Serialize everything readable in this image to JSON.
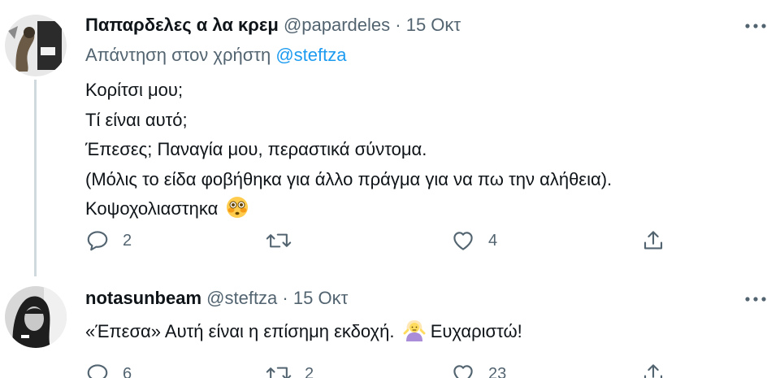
{
  "tweets": [
    {
      "display_name": "Παπαρδελες α λα κρεμ",
      "handle": "@papardeles",
      "separator": "·",
      "date": "15 Οκτ",
      "reply_prefix": "Απάντηση στον χρήστη",
      "reply_mention": "@steftza",
      "lines": [
        "Κορίτσι μου;",
        "Τί είναι αυτό;",
        "Έπεσες; Παναγία μου, περαστικά σύντομα.",
        "(Μόλις το είδα φοβήθηκα για άλλο πράγμα για να πω την αλήθεια).",
        "Κοψοχολιαστηκα"
      ],
      "emoji_icon": "flushed-face-icon",
      "replies": "2",
      "retweets": "",
      "likes": "4"
    },
    {
      "display_name": "notasunbeam",
      "handle": "@steftza",
      "separator": "·",
      "date": "15 Οκτ",
      "text_before_emoji": "«Έπεσα» Αυτή είναι η επίσημη εκδοχή.",
      "emoji_icon": "woman-shrugging-icon",
      "text_after_emoji": "Ευχαριστώ!",
      "replies": "6",
      "retweets": "2",
      "likes": "23"
    }
  ],
  "colors": {
    "text": "#0f1419",
    "secondary": "#536471",
    "link": "#1d9bf0",
    "thread_line": "#cfd9de"
  }
}
